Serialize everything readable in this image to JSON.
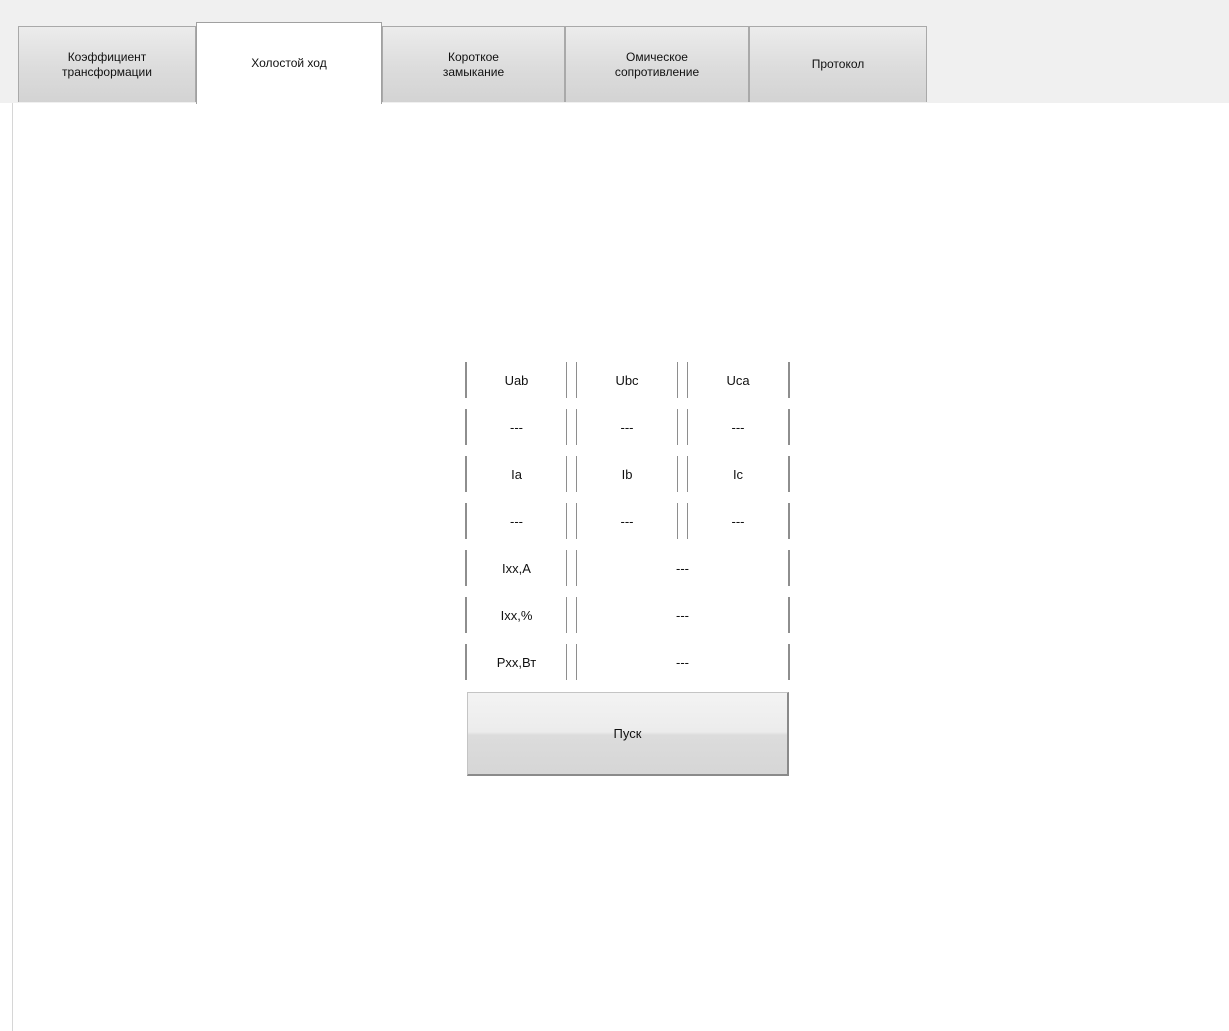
{
  "tabs": [
    {
      "label": "Коэффициент\nтрансформации"
    },
    {
      "label": "Холостой ход"
    },
    {
      "label": "Короткое\nзамыкание"
    },
    {
      "label": "Омическое\nсопротивление"
    },
    {
      "label": "Протокол"
    }
  ],
  "active_tab": "Холостой ход",
  "measurements": {
    "voltage_headers": [
      "Uab",
      "Ubc",
      "Uca"
    ],
    "voltage_values": [
      "---",
      "---",
      "---"
    ],
    "current_headers": [
      "Ia",
      "Ib",
      "Ic"
    ],
    "current_values": [
      "---",
      "---",
      "---"
    ],
    "summary": [
      {
        "label": "Ixx,A",
        "value": "---"
      },
      {
        "label": "Ixx,%",
        "value": "---"
      },
      {
        "label": "Pxx,Вт",
        "value": "---"
      }
    ]
  },
  "start_button": {
    "label": "Пуск"
  }
}
